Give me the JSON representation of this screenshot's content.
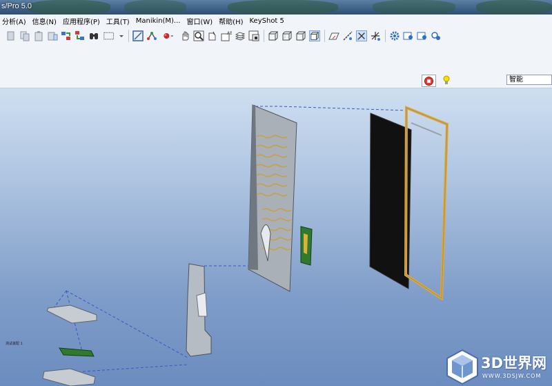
{
  "window": {
    "title": "s/Pro 5.0"
  },
  "menu": {
    "items": [
      "分析(A)",
      "信息(N)",
      "应用程序(P)",
      "工具(T)",
      "Manikin(M)...",
      "窗口(W)",
      "帮助(H)",
      "KeyShot 5"
    ]
  },
  "toolbar": {
    "icons": [
      "cut-icon",
      "copy-icon",
      "paste-icon",
      "paste-special-icon",
      "regenerate-icon",
      "regenerate-manager-icon",
      "find-icon",
      "select-box-icon",
      "dropdown-icon",
      "redraw-icon",
      "spin-center-icon",
      "orient-mode-icon",
      "pan-icon",
      "zoom-in-icon",
      "zoom-out-icon",
      "refit-icon",
      "named-views-icon",
      "layers-icon",
      "view-manager-icon",
      "wireframe-icon",
      "hidden-line-icon",
      "no-hidden-icon",
      "shading-icon",
      "datum-planes-icon",
      "datum-axes-icon",
      "datum-points-icon",
      "coord-sys-icon",
      "settings-icon",
      "spin-icon",
      "view-icon",
      "find-in-model-icon"
    ]
  },
  "status": {
    "filter_value": "智能"
  },
  "viewport": {
    "label": "测试装配 1"
  },
  "watermark": {
    "text": "3D世界网",
    "url": "WWW.3DSJW.COM",
    "color": "#4a6fa8"
  }
}
